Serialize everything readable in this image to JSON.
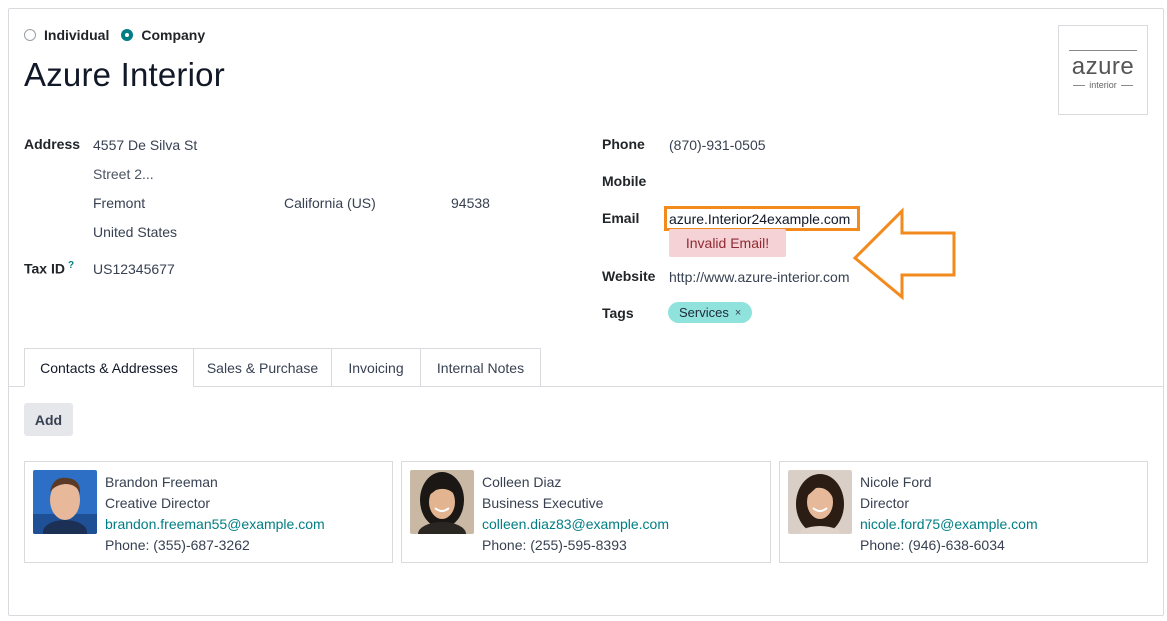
{
  "company_type": {
    "options": [
      "Individual",
      "Company"
    ],
    "selected": "Company"
  },
  "company": {
    "name": "Azure Interior",
    "logo": {
      "main": "azure",
      "sub": "interior"
    }
  },
  "address": {
    "label": "Address",
    "street": "4557 De Silva St",
    "street2_placeholder": "Street 2...",
    "city": "Fremont",
    "state": "California (US)",
    "zip": "94538",
    "country": "United States"
  },
  "tax": {
    "label": "Tax ID",
    "help": "?",
    "value": "US12345677"
  },
  "contact_fields": {
    "phone_label": "Phone",
    "phone": "(870)-931-0505",
    "mobile_label": "Mobile",
    "mobile": "",
    "email_label": "Email",
    "email": "azure.Interior24example.com",
    "email_error": "Invalid Email!",
    "website_label": "Website",
    "website": "http://www.azure-interior.com",
    "tags_label": "Tags",
    "tags": [
      "Services"
    ],
    "tag_remove": "×"
  },
  "annotation": {
    "color": "#f28a1e"
  },
  "tabs": [
    "Contacts & Addresses",
    "Sales & Purchase",
    "Invoicing",
    "Internal Notes"
  ],
  "active_tab": "Contacts & Addresses",
  "add_button": "Add",
  "contacts": [
    {
      "name": "Brandon Freeman",
      "title": "Creative Director",
      "email": "brandon.freeman55@example.com",
      "phone": "Phone: (355)-687-3262"
    },
    {
      "name": "Colleen Diaz",
      "title": "Business Executive",
      "email": "colleen.diaz83@example.com",
      "phone": "Phone: (255)-595-8393"
    },
    {
      "name": "Nicole Ford",
      "title": "Director",
      "email": "nicole.ford75@example.com",
      "phone": "Phone: (946)-638-6034"
    }
  ],
  "colors": {
    "accent": "#017e84",
    "tag_bg": "#8fe3dc",
    "error_bg": "#f4d2d5"
  }
}
